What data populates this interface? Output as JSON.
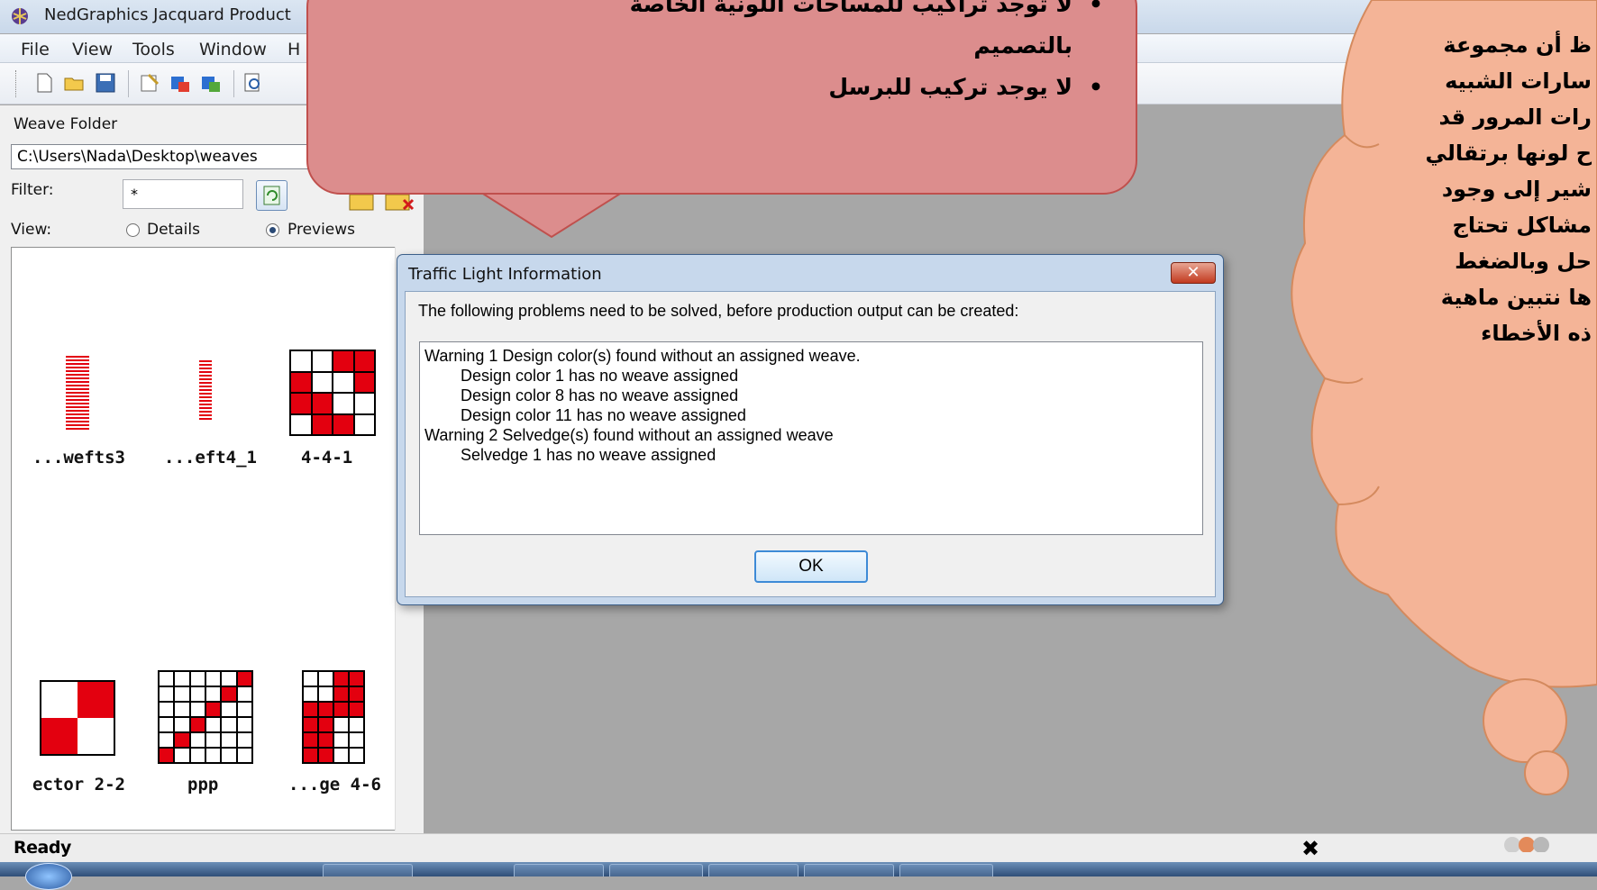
{
  "window": {
    "title": "NedGraphics Jacquard Product"
  },
  "menu": {
    "items": [
      "File",
      "View",
      "Tools",
      "Window",
      "H"
    ]
  },
  "panel": {
    "weave_folder_label": "Weave Folder",
    "path": "C:\\Users\\Nada\\Desktop\\weaves",
    "filter_label": "Filter:",
    "filter_value": "*",
    "view_label": "View:",
    "details_label": "Details",
    "previews_label": "Previews",
    "view_selected": "Previews",
    "thumbnails": [
      {
        "caption": "...wefts3"
      },
      {
        "caption": "...eft4_1"
      },
      {
        "caption": "4-4-1"
      },
      {
        "caption": "ector 2-2"
      },
      {
        "caption": "ppp"
      },
      {
        "caption": "...ge 4-6"
      }
    ]
  },
  "dialog": {
    "title": "Traffic Light Information",
    "close_label": "✕",
    "message": "The following problems need to be solved, before production output can be created:",
    "lines": [
      {
        "text": "Warning 1  Design color(s) found without an assigned weave.",
        "indent": false
      },
      {
        "text": "Design color 1 has no weave assigned",
        "indent": true
      },
      {
        "text": "Design color 8 has no weave assigned",
        "indent": true
      },
      {
        "text": "Design color 11 has no weave assigned",
        "indent": true
      },
      {
        "text": "Warning 2  Selvedge(s) found without an assigned weave",
        "indent": false
      },
      {
        "text": "Selvedge 1 has no weave assigned",
        "indent": true
      }
    ],
    "ok_label": "OK"
  },
  "callout": {
    "lines": [
      {
        "text": "لا توجد تراكيب للمساحات اللونية الخاصة",
        "bullet": true
      },
      {
        "text": "بالتصميم",
        "bullet": false
      },
      {
        "text": "لا يوجد تركيب للبرسل",
        "bullet": true
      }
    ]
  },
  "cloud": {
    "lines": [
      "ظ أن مجموعة",
      "سارات الشبيه",
      "رات المرور قد",
      "ح لونها برتقالي",
      "شير إلى وجود",
      "مشاكل تحتاج",
      "حل وبالضغط",
      "ها نتبين ماهية",
      "ذه الأخطاء"
    ]
  },
  "status": {
    "text": "Ready"
  },
  "colors": {
    "weave_red": "#e3000f",
    "callout_fill": "#dc8d8d",
    "cloud_fill": "#f4b497",
    "dialog_frame": "#c7d8ec"
  }
}
